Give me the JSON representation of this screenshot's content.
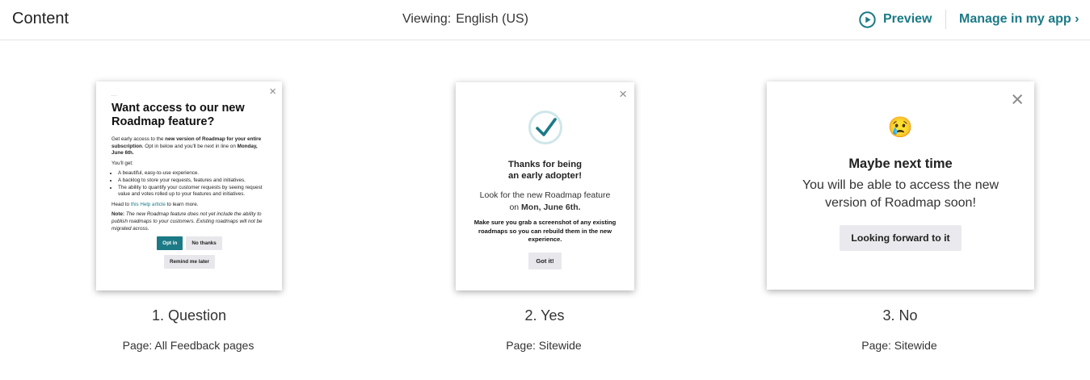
{
  "header": {
    "title": "Content",
    "viewing_label": "Viewing:",
    "viewing_value": "English (US)",
    "preview_label": "Preview",
    "manage_label": "Manage in my app ›"
  },
  "colors": {
    "accent": "#1b7a86",
    "button_gray": "#e8e8ec",
    "divider": "#e3e3e3"
  },
  "cards": [
    {
      "dots": "...",
      "close": "×",
      "title": "Want access to our new Roadmap feature?",
      "intro_pre": "Get early access to the ",
      "intro_bold1": "new version of Roadmap for your entire subscription",
      "intro_mid": ". Opt in below and you'll be next in line on ",
      "intro_bold2": "Monday, June 6th.",
      "youll_get": "You'll get:",
      "bullets": [
        "A beautiful, easy-to-use experience.",
        "A backlog to store your requests, features and initiatives.",
        "The ability to quantify your customer requests by seeing request value and votes rolled up to your features and initiatives."
      ],
      "head_pre": "Head to ",
      "head_link": "this Help article",
      "head_post": " to learn more.",
      "note_label": "Note:",
      "note_text": " The new Roadmap feature does not yet include the ability to publish roadmaps to your customers. Existing roadmaps will not be migrated across.",
      "btn_optin": "Opt in",
      "btn_nothanks": "No thanks",
      "btn_remind": "Remind me later",
      "caption": "1. Question",
      "page": "Page: All Feedback pages"
    },
    {
      "close": "×",
      "icon": "checkmark-circle-icon",
      "title_line1": "Thanks for being",
      "title_line2": "an early adopter!",
      "body_line1": "Look for the new Roadmap feature",
      "body_on": "on ",
      "body_date": "Mon, June 6th.",
      "strong": "Make sure you grab a screenshot of any existing roadmaps so you can rebuild them in the new experience.",
      "button": "Got it!",
      "caption": "2. Yes",
      "page": "Page: Sitewide"
    },
    {
      "close": "×",
      "emoji": "😢",
      "title": "Maybe next time",
      "body_line1": "You will be able to access the new",
      "body_line2": "version of Roadmap soon!",
      "button": "Looking forward to it",
      "caption": "3. No",
      "page": "Page: Sitewide"
    }
  ]
}
